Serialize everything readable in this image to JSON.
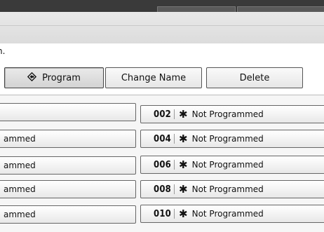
{
  "message": {
    "text": "n."
  },
  "toolbar": {
    "program_label": "Program",
    "program_icon": "program-diamond-icon",
    "change_name_label": "Change Name",
    "delete_label": "Delete"
  },
  "programs": {
    "left": [
      {
        "label": ""
      },
      {
        "label": "ammed"
      },
      {
        "label": "ammed"
      },
      {
        "label": "ammed"
      },
      {
        "label": "ammed"
      }
    ],
    "right": [
      {
        "number": "002",
        "marker": "✱",
        "status": "Not Programmed"
      },
      {
        "number": "004",
        "marker": "✱",
        "status": "Not Programmed"
      },
      {
        "number": "006",
        "marker": "✱",
        "status": "Not Programmed"
      },
      {
        "number": "008",
        "marker": "✱",
        "status": "Not Programmed"
      },
      {
        "number": "010",
        "marker": "✱",
        "status": "Not Programmed"
      }
    ]
  }
}
